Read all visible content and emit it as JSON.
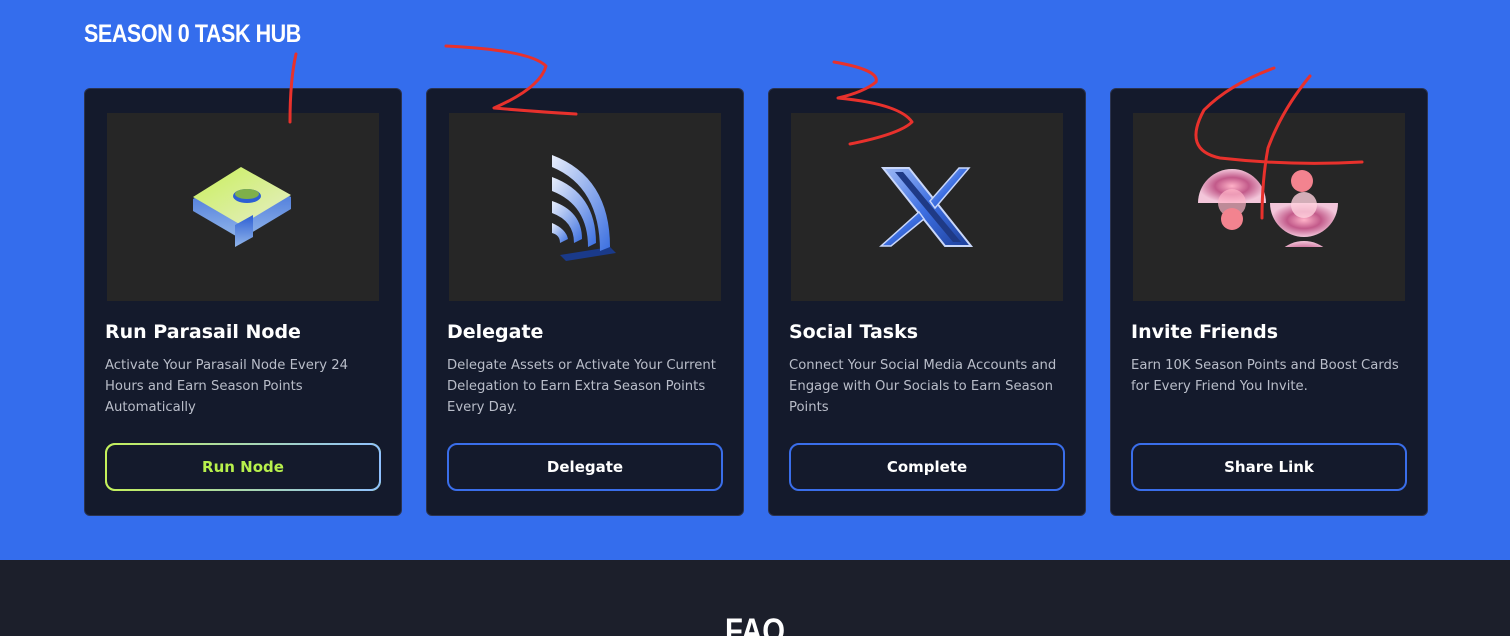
{
  "hub": {
    "title": "Season 0 Task Hub",
    "cards": [
      {
        "title": "Run Parasail Node",
        "description": "Activate Your Parasail Node Every 24 Hours and Earn Season Points Automatically",
        "button": "Run Node",
        "icon": "parasail-node-icon"
      },
      {
        "title": "Delegate",
        "description": "Delegate Assets or Activate Your Current Delegation to Earn Extra Season Points Every Day.",
        "button": "Delegate",
        "icon": "delegate-signal-icon"
      },
      {
        "title": "Social Tasks",
        "description": "Connect Your Social Media Accounts and Engage with Our Socials to Earn Season Points",
        "button": "Complete",
        "icon": "x-logo-icon"
      },
      {
        "title": "Invite Friends",
        "description": "Earn 10K Season Points and Boost Cards for Every Friend You Invite.",
        "button": "Share Link",
        "icon": "invite-friends-icon"
      }
    ]
  },
  "faq": {
    "title": "FAQ"
  },
  "annotations": {
    "marks": [
      "1",
      "2",
      "3",
      "4"
    ],
    "color": "#e8312c"
  },
  "colors": {
    "page_bg": "#346ded",
    "card_bg": "#141a2c",
    "button_border": "#3a6eea",
    "primary_button_text": "#b8f04c",
    "footer_bg": "#1c1f2b"
  }
}
